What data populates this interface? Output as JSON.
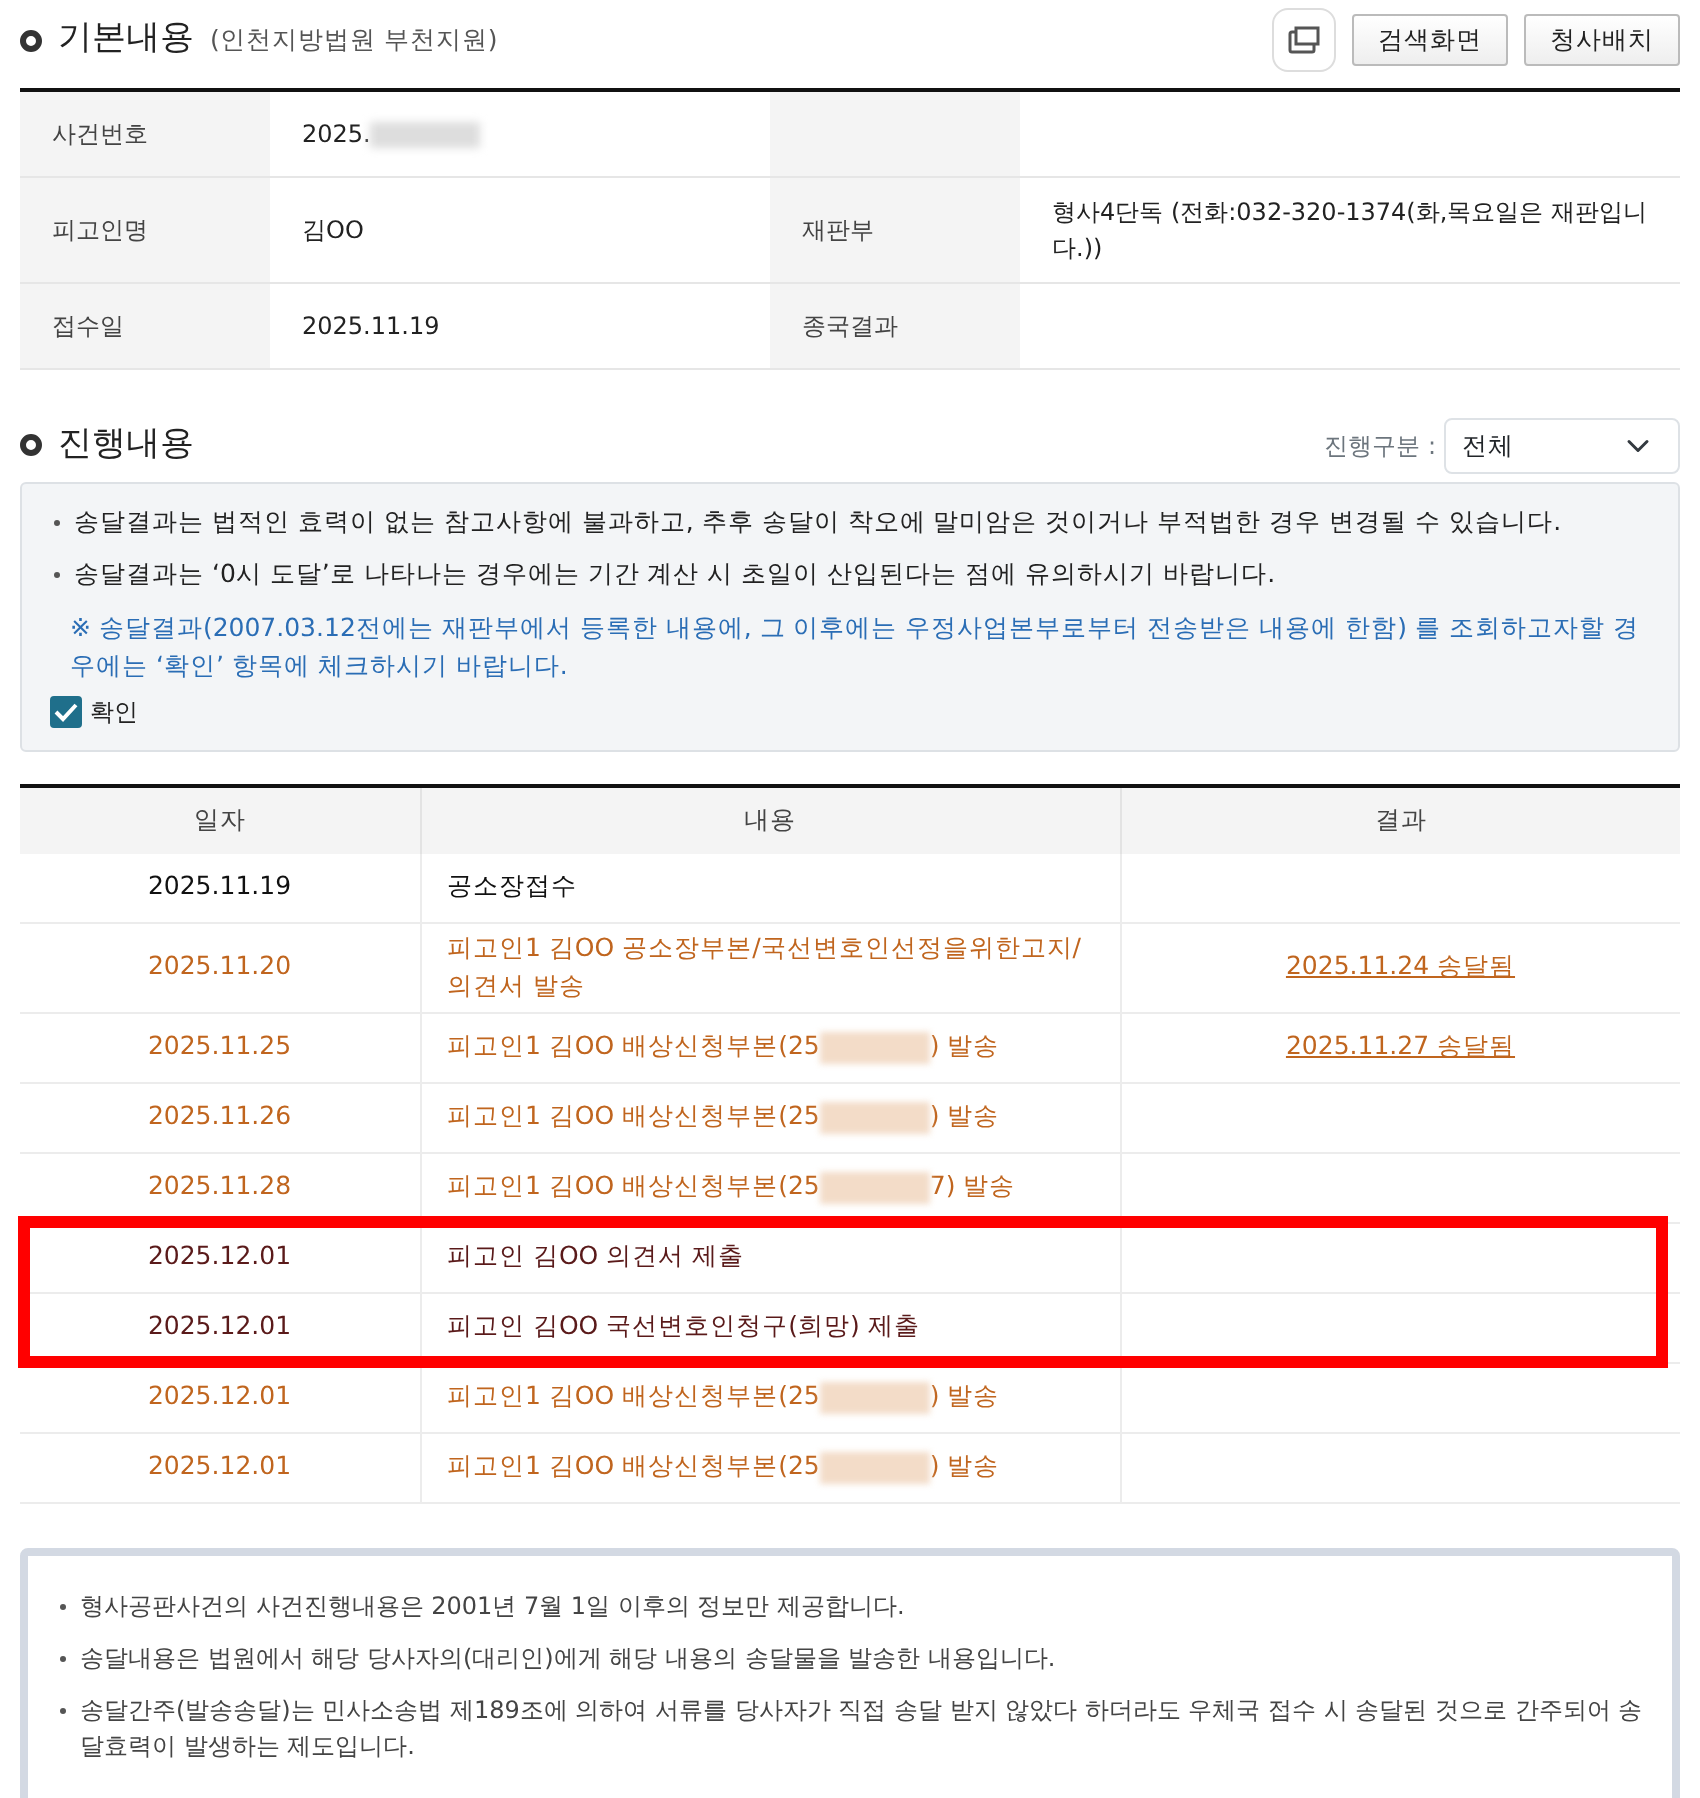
{
  "basic": {
    "title": "기본내용",
    "court": "(인천지방법원 부천지원)",
    "buttons": [
      "검색화면",
      "청사배치"
    ],
    "fields": [
      {
        "label": "사건번호",
        "value": "2025.",
        "redacted": true
      },
      {
        "label": "피고인명",
        "value": "김OO",
        "label2": "재판부",
        "value2": "형사4단독 (전화:032-320-1374(화,목요일은 재판입니다.))"
      },
      {
        "label": "접수일",
        "value": "2025.11.19",
        "label2": "종국결과"
      }
    ]
  },
  "progress": {
    "title": "진행내용",
    "filter_label": "진행구분 :",
    "filter_value": "전체",
    "notices": [
      "송달결과는 법적인 효력이 없는 참고사항에 불과하고, 추후 송달이 착오에 말미암은 것이거나 부적법한 경우 변경될 수 있습니다.",
      "송달결과는 ‘0시 도달’로 나타나는 경우에는 기간 계산 시 초일이 산입된다는 점에 유의하시기 바랍니다."
    ],
    "info": "※ 송달결과(2007.03.12전에는 재판부에서 등록한 내용에, 그 이후에는 우정사업본부로부터 전송받은 내용에 한함) 를 조회하고자할 경우에는 ‘확인’ 항목에 체크하시기 바랍니다.",
    "confirm": {
      "label": "확인",
      "checked": true
    },
    "columns": [
      "일자",
      "내용",
      "결과"
    ],
    "rows": [
      {
        "date": "2025.11.19",
        "content": "공소장접수",
        "color": "#111111",
        "highlighted": false
      },
      {
        "date": "2025.11.20",
        "content": "피고인1 김OO 공소장부본/국선변호인선정을위한고지/의견서 발송",
        "result": "2025.11.24 송달됨",
        "color": "#c0651e",
        "highlighted": false
      },
      {
        "date": "2025.11.25",
        "content": "피고인1 김OO 배상신청부본(25",
        "content_tail": ") 발송",
        "result": "2025.11.27 송달됨",
        "color": "#c0651e",
        "highlighted": false
      },
      {
        "date": "2025.11.26",
        "content": "피고인1 김OO 배상신청부본(25",
        "content_tail": ") 발송",
        "color": "#c0651e",
        "highlighted": false
      },
      {
        "date": "2025.11.28",
        "content": "피고인1 김OO 배상신청부본(25",
        "content_tail": "7) 발송",
        "color": "#c0651e",
        "highlighted": false
      },
      {
        "date": "2025.12.01",
        "content": "피고인 김OO 의견서 제출",
        "color": "#5a1a1a",
        "highlighted": true
      },
      {
        "date": "2025.12.01",
        "content": "피고인 김OO 국선변호인청구(희망) 제출",
        "color": "#5a1a1a",
        "highlighted": true
      },
      {
        "date": "2025.12.01",
        "content": "피고인1 김OO 배상신청부본(25",
        "content_tail": ") 발송",
        "color": "#c0651e",
        "highlighted": false
      },
      {
        "date": "2025.12.01",
        "content": "피고인1 김OO 배상신청부본(25",
        "content_tail": ") 발송",
        "color": "#c0651e",
        "highlighted": false
      }
    ]
  },
  "footnotes": [
    "형사공판사건의 사건진행내용은 2001년 7월 1일 이후의 정보만 제공합니다.",
    "송달내용은 법원에서 해당 당사자의(대리인)에게 해당 내용의 송달물을 발송한 내용입니다.",
    "송달간주(발송송달)는 민사소송법 제189조에 의하여 서류를 당사자가 직접 송달 받지 않았다 하더라도 우체국 접수 시 송달된 것으로 간주되어 송달효력이 발생하는 제도입니다."
  ]
}
